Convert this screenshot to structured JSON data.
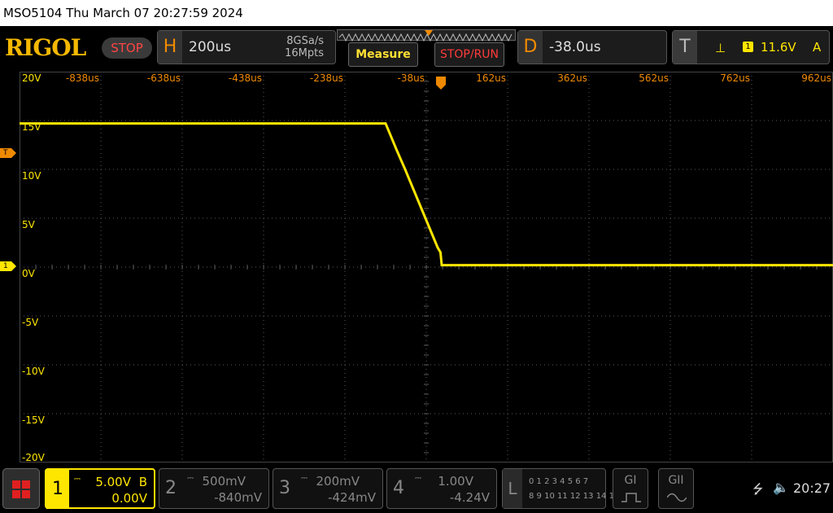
{
  "titlebar": {
    "text": "MSO5104  Thu March 07 20:27:59 2024"
  },
  "brand": {
    "logo": "RIGOL",
    "run_state": "STOP"
  },
  "horizontal": {
    "letter": "H",
    "timebase": "200us",
    "sample_rate": "8GSa/s",
    "memory_depth": "16Mpts"
  },
  "buttons": {
    "measure": "Measure",
    "stop_run": "STOP/RUN"
  },
  "delay": {
    "letter": "D",
    "value": "-38.0us"
  },
  "trigger": {
    "letter": "T",
    "edge_icon": "rising-edge-icon",
    "edge_glyph": "⊥",
    "source": "1",
    "level": "11.6V",
    "mode": "A"
  },
  "grid": {
    "time_labels": [
      "-838us",
      "-638us",
      "-438us",
      "-238us",
      "-38us",
      "162us",
      "362us",
      "562us",
      "762us",
      "962us"
    ],
    "volt_labels": [
      "20V",
      "15V",
      "10V",
      "5V",
      "0V",
      "-5V",
      "-10V",
      "-15V",
      "-20V"
    ],
    "trigger_marker_label": "T",
    "ch1_marker_label": "1"
  },
  "chart_data": {
    "type": "line",
    "title": "",
    "xlabel": "",
    "ylabel": "",
    "x_units": "us",
    "y_units": "V",
    "xlim": [
      -938,
      1062
    ],
    "ylim": [
      -20,
      20
    ],
    "grid": true,
    "series": [
      {
        "name": "",
        "color": "#ffe600",
        "x": [
          -938,
          -38,
          -30,
          -10,
          10,
          30,
          50,
          70,
          90,
          97,
          100,
          200,
          400,
          600,
          800,
          1062
        ],
        "y": [
          14.7,
          14.7,
          13.9,
          11.9,
          10.0,
          8.0,
          6.0,
          4.0,
          2.0,
          1.5,
          0.2,
          0.2,
          0.2,
          0.2,
          0.2,
          0.2
        ]
      }
    ]
  },
  "channels": [
    {
      "num": "1",
      "coupling": "DC",
      "scale": "5.00V",
      "bw": "B",
      "offset": "0.00V",
      "active": true
    },
    {
      "num": "2",
      "coupling": "DC",
      "scale": "500mV",
      "bw": "",
      "offset": "-840mV",
      "active": false
    },
    {
      "num": "3",
      "coupling": "DC",
      "scale": "200mV",
      "bw": "",
      "offset": "-424mV",
      "active": false
    },
    {
      "num": "4",
      "coupling": "DC",
      "scale": "1.00V",
      "bw": "",
      "offset": "-4.24V",
      "active": false
    }
  ],
  "logic": {
    "letter": "L",
    "row1": "0 1 2 3  4 5 6 7",
    "row2": "8 9 10 11  12 13 14 15"
  },
  "generators": {
    "g1": "GI",
    "g2": "GII"
  },
  "status": {
    "usb_icon": "usb-icon",
    "volume_icon": "speaker-mute-icon",
    "time": "20:27"
  },
  "colors": {
    "ch1": "#ffe600",
    "accent": "#f08a00",
    "grid": "#5a5a5a"
  }
}
